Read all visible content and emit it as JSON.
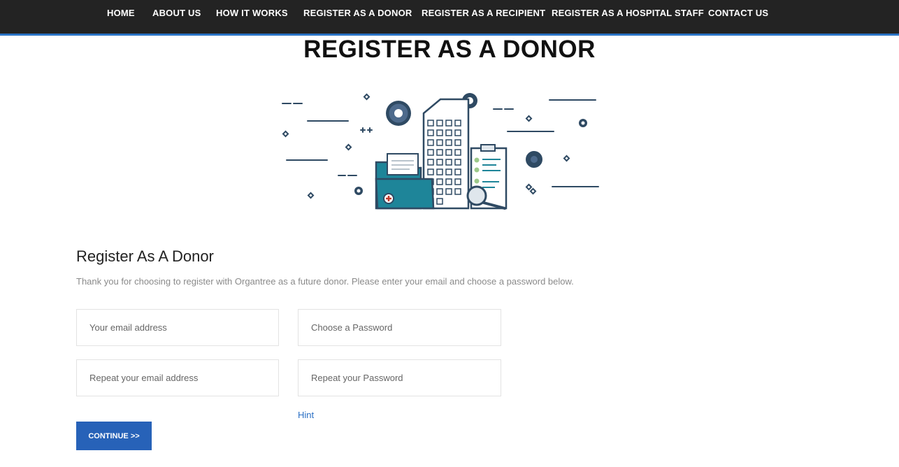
{
  "nav": {
    "items": [
      {
        "label": "HOME"
      },
      {
        "label": "ABOUT US"
      },
      {
        "label": "HOW IT WORKS"
      },
      {
        "label": "REGISTER AS A DONOR"
      },
      {
        "label": "REGISTER AS A RECIPIENT"
      },
      {
        "label": "REGISTER AS A HOSPITAL STAFF"
      },
      {
        "label": "CONTACT US"
      }
    ]
  },
  "page": {
    "heading": "REGISTER AS A DONOR"
  },
  "hero": {
    "illustration": "hospital-building-documents-illustration",
    "colors": {
      "dark": "#2f4a63",
      "teal": "#1e8599",
      "light": "#dfe6ec",
      "green": "#9cc98a"
    }
  },
  "form": {
    "title": "Register As A Donor",
    "subtitle": "Thank you for choosing to register with Organtree as a future donor. Please enter your email and choose a password below.",
    "email_placeholder": "Your email address",
    "password_placeholder": "Choose a Password",
    "repeat_email_placeholder": "Repeat your email address",
    "repeat_password_placeholder": "Repeat your Password",
    "hint_label": "Hint",
    "continue_label": "CONTINUE >>"
  },
  "colors": {
    "nav_bg": "#232323",
    "nav_accent": "#2a73c4",
    "button_bg": "#2762b8",
    "link": "#2a6fc4"
  }
}
